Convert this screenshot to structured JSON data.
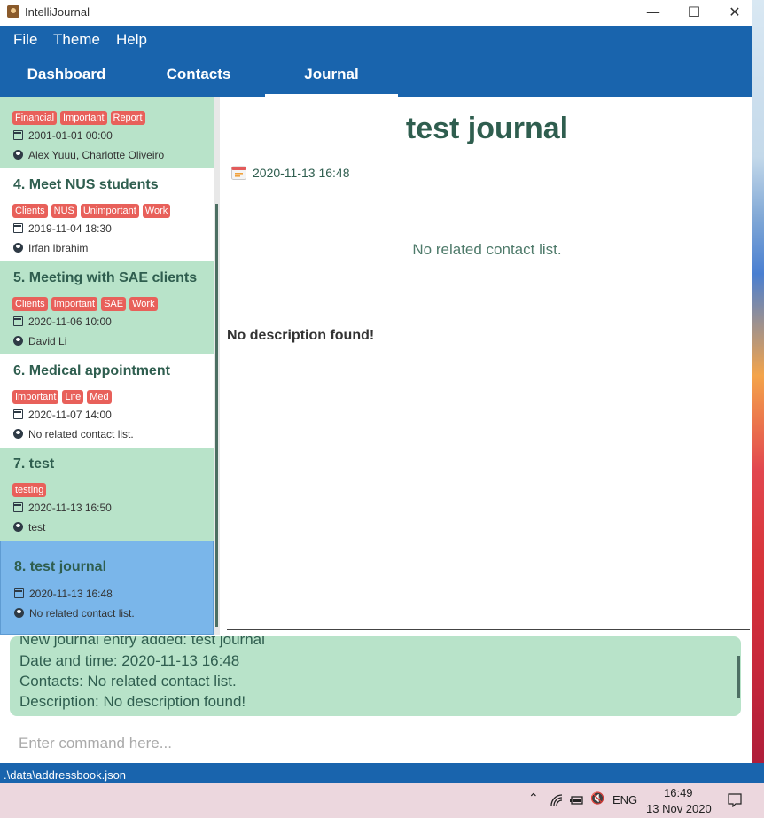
{
  "window": {
    "title": "IntelliJournal"
  },
  "menu": {
    "file": "File",
    "theme": "Theme",
    "help": "Help"
  },
  "tabs": {
    "dashboard": "Dashboard",
    "contacts": "Contacts",
    "journal": "Journal"
  },
  "entries": [
    {
      "title": "",
      "tags": [
        "Financial",
        "Important",
        "Report"
      ],
      "datetime": "2001-01-01 00:00",
      "contacts": "Alex Yuuu, Charlotte Oliveiro"
    },
    {
      "title": "4.  Meet NUS students",
      "tags": [
        "Clients",
        "NUS",
        "Unimportant",
        "Work"
      ],
      "datetime": "2019-11-04 18:30",
      "contacts": "Irfan Ibrahim"
    },
    {
      "title": "5.  Meeting with SAE clients",
      "tags": [
        "Clients",
        "Important",
        "SAE",
        "Work"
      ],
      "datetime": "2020-11-06 10:00",
      "contacts": "David Li"
    },
    {
      "title": "6.  Medical appointment",
      "tags": [
        "Important",
        "Life",
        "Med"
      ],
      "datetime": "2020-11-07 14:00",
      "contacts": "No related contact list."
    },
    {
      "title": "7.  test",
      "tags": [
        "testing"
      ],
      "datetime": "2020-11-13 16:50",
      "contacts": "test"
    },
    {
      "title": "8.  test journal",
      "tags": [],
      "datetime": "2020-11-13 16:48",
      "contacts": "No related contact list."
    }
  ],
  "detail": {
    "title": "test journal",
    "datetime": "2020-11-13 16:48",
    "contacts_text": "No related contact list.",
    "description": "No description found!"
  },
  "result": {
    "line1": "New journal entry added: test journal",
    "line2": "Date and time: 2020-11-13 16:48",
    "line3": "Contacts: No related contact list.",
    "line4": "Description: No description found!"
  },
  "command": {
    "placeholder": "Enter command here..."
  },
  "status": {
    "path": ".\\data\\addressbook.json"
  },
  "taskbar": {
    "lang": "ENG",
    "time": "16:49",
    "date": "13 Nov 2020"
  }
}
